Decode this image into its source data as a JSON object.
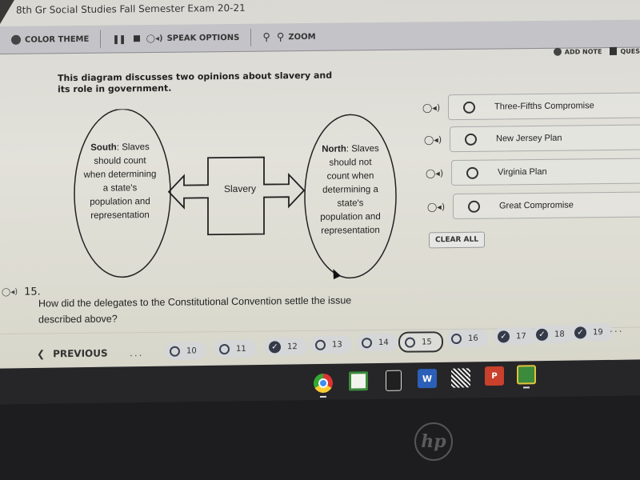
{
  "window": {
    "title": "8th Gr Social Studies Fall Semester Exam 20-21"
  },
  "toolbar": {
    "color_theme_label": "COLOR THEME",
    "speak_options_label": "SPEAK OPTIONS",
    "zoom_label": "ZOOM",
    "pause_glyph": "❚❚",
    "speaker_glyph": "◯◂)",
    "zoom_out_glyph": "⚲",
    "zoom_in_glyph": "⚲"
  },
  "right_tools": {
    "add_note_label": "ADD NOTE",
    "question_label": "QUES"
  },
  "question": {
    "prompt": "This diagram discusses two opinions about slavery and its role in government.",
    "number": "15.",
    "text": "How did the delegates to the Constitutional Convention settle the issue described above?",
    "speaker_glyph": "◯◂)"
  },
  "diagram": {
    "south_label": "South",
    "south_text": ": Slaves should count when determining a state's population and representation",
    "north_label": "North",
    "north_text": ": Slaves should not count when determining a state's population and representation",
    "center_label": "Slavery"
  },
  "options": [
    {
      "label": "Three-Fifths Compromise",
      "selected": false
    },
    {
      "label": "New Jersey Plan",
      "selected": false
    },
    {
      "label": "Virginia Plan",
      "selected": false
    },
    {
      "label": "Great Compromise",
      "selected": false
    }
  ],
  "clear_all_label": "CLEAR ALL",
  "navigation": {
    "previous_label": "PREVIOUS",
    "previous_glyph": "❮",
    "ellipsis": "...",
    "questions": [
      {
        "number": "10",
        "answered": false,
        "current": false
      },
      {
        "number": "11",
        "answered": false,
        "current": false
      },
      {
        "number": "12",
        "answered": true,
        "current": false
      },
      {
        "number": "13",
        "answered": false,
        "current": false
      },
      {
        "number": "14",
        "answered": false,
        "current": false
      },
      {
        "number": "15",
        "answered": false,
        "current": true
      },
      {
        "number": "16",
        "answered": false,
        "current": false
      },
      {
        "number": "17",
        "answered": true,
        "current": false
      },
      {
        "number": "18",
        "answered": true,
        "current": false
      },
      {
        "number": "19",
        "answered": true,
        "current": false
      }
    ],
    "check_glyph": "✓"
  },
  "shelf": {
    "apps": [
      "chrome-icon",
      "power-app-icon",
      "calculator-app-icon",
      "word-icon",
      "qr-code-app-icon",
      "powerpoint-icon",
      "google-classroom-icon"
    ]
  },
  "device": {
    "brand": "hp"
  }
}
